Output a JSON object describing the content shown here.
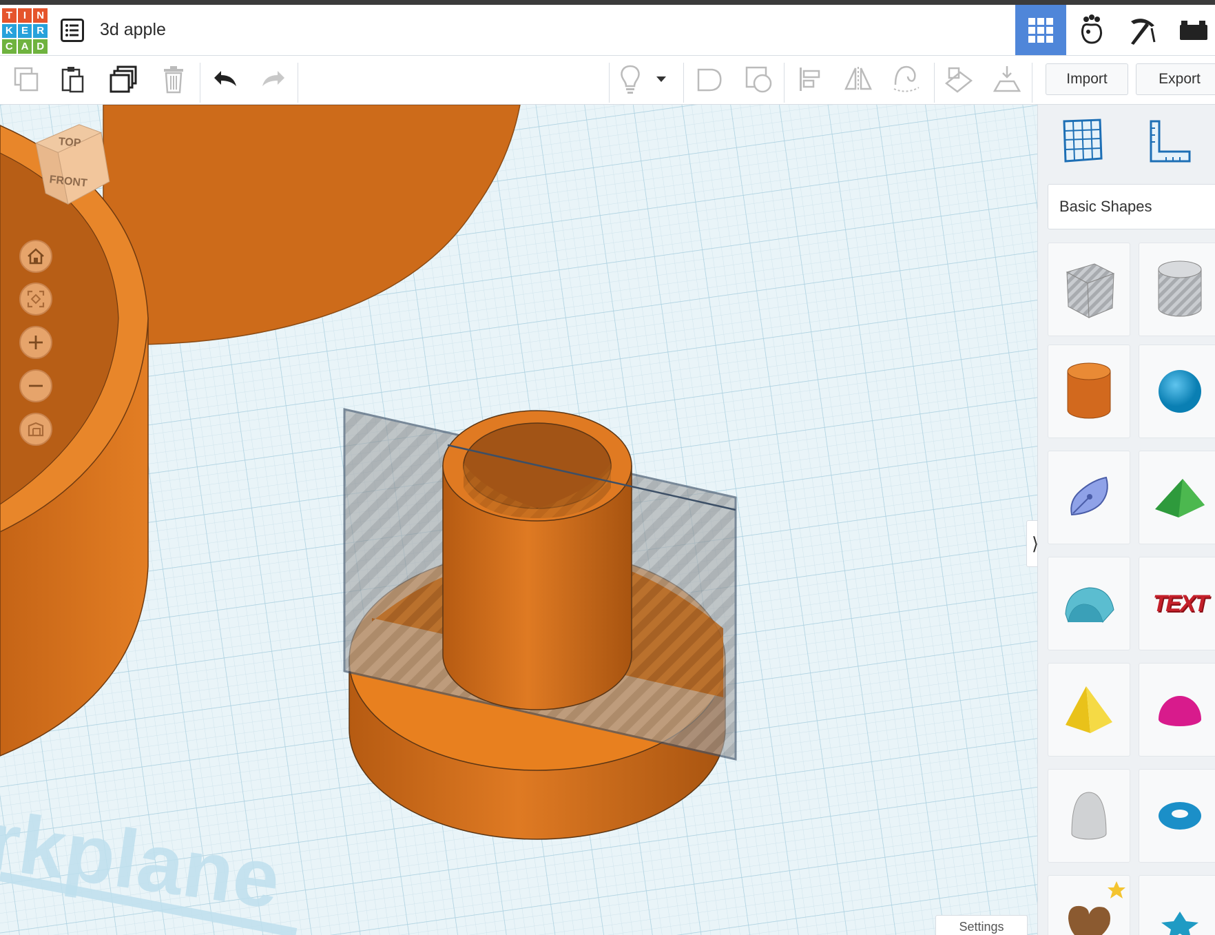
{
  "app": {
    "logo_letters": [
      "T",
      "I",
      "N",
      "K",
      "E",
      "R",
      "C",
      "A",
      "D"
    ],
    "logo_colors": [
      "#e5542c",
      "#e5542c",
      "#e5542c",
      "#27a2db",
      "#27a2db",
      "#27a2db",
      "#6fb33f",
      "#6fb33f",
      "#6fb33f"
    ],
    "document_title": "3d apple",
    "accent_color": "#4f86d9"
  },
  "header_modes": [
    {
      "name": "3d-design-grid-icon",
      "active": true
    },
    {
      "name": "codeblocks-icon",
      "active": false
    },
    {
      "name": "minecraft-pickaxe-icon",
      "active": false
    },
    {
      "name": "brick-lego-icon",
      "active": false
    }
  ],
  "toolbar": {
    "left_tools": [
      "copy-icon",
      "paste-icon",
      "duplicate-icon",
      "delete-icon",
      "undo-icon",
      "redo-icon"
    ],
    "right_tools": [
      "lightbulb-icon",
      "dropdown-caret-icon",
      "solid-shape-icon",
      "hole-shape-icon",
      "align-icon",
      "mirror-icon",
      "group-icon",
      "workplane-tool-icon",
      "drop-to-workplane-icon"
    ],
    "import_label": "Import",
    "export_label": "Export"
  },
  "viewcube": {
    "top_label": "TOP",
    "front_label": "FRONT"
  },
  "view_nav": [
    "home-icon",
    "fit-view-icon",
    "zoom-in-icon",
    "zoom-out-icon",
    "ortho-perspective-icon"
  ],
  "workplane_label": "rkplane",
  "sidebar": {
    "tools": [
      "workplane-grid-icon",
      "ruler-icon"
    ],
    "category_label": "Basic Shapes",
    "shapes": [
      {
        "name": "box-hole-shape"
      },
      {
        "name": "cylinder-hole-shape"
      },
      {
        "name": "cylinder-shape"
      },
      {
        "name": "sphere-shape"
      },
      {
        "name": "scribble-shape"
      },
      {
        "name": "roof-shape"
      },
      {
        "name": "round-roof-shape"
      },
      {
        "name": "text-shape",
        "text": "TEXT"
      },
      {
        "name": "pyramid-shape"
      },
      {
        "name": "half-sphere-shape"
      },
      {
        "name": "paraboloid-shape"
      },
      {
        "name": "torus-shape"
      },
      {
        "name": "heart-shape"
      },
      {
        "name": "star-shape"
      }
    ]
  },
  "collapse_glyph": "⟩",
  "settings_label": "Settings"
}
